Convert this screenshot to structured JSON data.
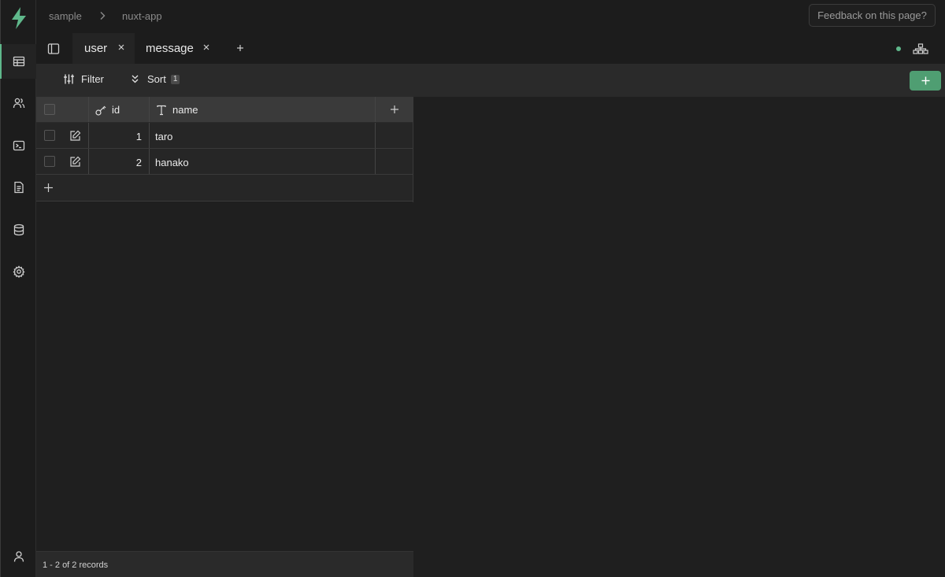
{
  "breadcrumb": {
    "project": "sample",
    "app": "nuxt-app"
  },
  "header": {
    "feedback_label": "Feedback on this page?"
  },
  "tabs": [
    {
      "label": "user",
      "active": true
    },
    {
      "label": "message",
      "active": false
    }
  ],
  "toolbar": {
    "filter_label": "Filter",
    "sort_label": "Sort",
    "sort_count": "1"
  },
  "table": {
    "columns": [
      {
        "name": "id",
        "icon": "key-icon"
      },
      {
        "name": "name",
        "icon": "text-type-icon"
      }
    ],
    "rows": [
      {
        "id": "1",
        "name": "taro"
      },
      {
        "id": "2",
        "name": "hanako"
      }
    ]
  },
  "footer": {
    "records_text": "1 - 2 of 2 records"
  },
  "colors": {
    "accent": "#5fb88b",
    "button": "#4f9e72",
    "background": "#1f1f1f"
  },
  "sidebar": {
    "items": [
      {
        "icon": "table-icon",
        "active": true
      },
      {
        "icon": "users-icon",
        "active": false
      },
      {
        "icon": "terminal-icon",
        "active": false
      },
      {
        "icon": "document-icon",
        "active": false
      },
      {
        "icon": "database-icon",
        "active": false
      },
      {
        "icon": "settings-icon",
        "active": false
      },
      {
        "icon": "account-icon",
        "active": false
      }
    ]
  }
}
